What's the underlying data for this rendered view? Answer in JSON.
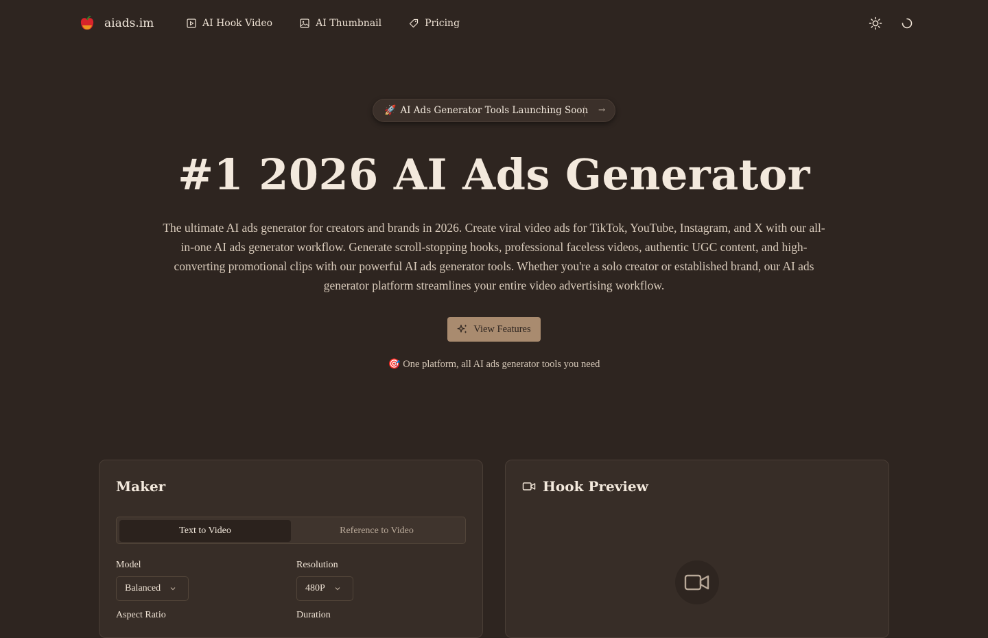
{
  "nav": {
    "brand": "aiads.im",
    "links": [
      {
        "label": "AI Hook Video",
        "icon": "play-square-icon"
      },
      {
        "label": "AI Thumbnail",
        "icon": "image-icon"
      },
      {
        "label": "Pricing",
        "icon": "tag-icon"
      }
    ]
  },
  "badge": {
    "emoji": "🚀",
    "label": "AI Ads Generator Tools Launching Soon",
    "arrow": "→"
  },
  "hero": {
    "title": "#1 2026 AI Ads Generator",
    "subtitle": "The ultimate AI ads generator for creators and brands in 2026. Create viral video ads for TikTok, YouTube, Instagram, and X with our all-in-one AI ads generator workflow. Generate scroll-stopping hooks, professional faceless videos, authentic UGC content, and high-converting promotional clips with our powerful AI ads generator tools. Whether you're a solo creator or established brand, our AI ads generator platform streamlines your entire video advertising workflow.",
    "cta": "View Features",
    "tagline": "🎯 One platform, all AI ads generator tools you need"
  },
  "maker": {
    "title": "Maker",
    "tabs": [
      "Text to Video",
      "Reference to Video"
    ],
    "model_label": "Model",
    "model_value": "Balanced",
    "resolution_label": "Resolution",
    "resolution_value": "480P",
    "aspect_label": "Aspect Ratio",
    "duration_label": "Duration"
  },
  "preview": {
    "title": "Hook Preview"
  },
  "colors": {
    "background": "#2e2520",
    "accent": "#a98b6f",
    "card": "#372d27"
  }
}
